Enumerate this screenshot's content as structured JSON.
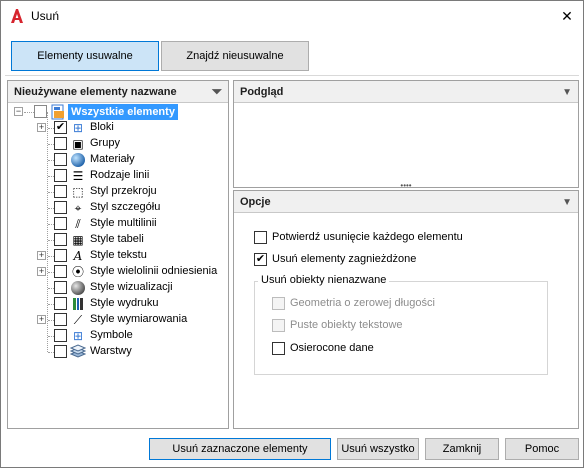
{
  "window": {
    "title": "Usuń"
  },
  "tabs": [
    {
      "label": "Elementy usuwalne",
      "active": true
    },
    {
      "label": "Znajdź nieusuwalne",
      "active": false
    }
  ],
  "left_panel": {
    "header": "Nieużywane elementy nazwane",
    "root": {
      "label": "Wszystkie elementy",
      "checked": false
    },
    "items": [
      {
        "label": "Bloki",
        "checked": true,
        "expandable": true,
        "icon": "block-icon"
      },
      {
        "label": "Grupy",
        "checked": false,
        "expandable": false,
        "icon": "group-icon"
      },
      {
        "label": "Materiały",
        "checked": false,
        "expandable": false,
        "icon": "material-sphere-icon"
      },
      {
        "label": "Rodzaje linii",
        "checked": false,
        "expandable": false,
        "icon": "linetype-icon"
      },
      {
        "label": "Styl przekroju",
        "checked": false,
        "expandable": false,
        "icon": "section-style-icon"
      },
      {
        "label": "Styl szczegółu",
        "checked": false,
        "expandable": false,
        "icon": "detail-style-icon"
      },
      {
        "label": "Style multilinii",
        "checked": false,
        "expandable": false,
        "icon": "multiline-style-icon"
      },
      {
        "label": "Style tabeli",
        "checked": false,
        "expandable": false,
        "icon": "table-style-icon"
      },
      {
        "label": "Style tekstu",
        "checked": false,
        "expandable": true,
        "icon": "text-style-icon"
      },
      {
        "label": "Style wielolinii odniesienia",
        "checked": false,
        "expandable": true,
        "icon": "multileader-style-icon"
      },
      {
        "label": "Style wizualizacji",
        "checked": false,
        "expandable": false,
        "icon": "visual-style-icon"
      },
      {
        "label": "Style wydruku",
        "checked": false,
        "expandable": false,
        "icon": "plot-style-icon"
      },
      {
        "label": "Style wymiarowania",
        "checked": false,
        "expandable": true,
        "icon": "dimension-style-icon"
      },
      {
        "label": "Symbole",
        "checked": false,
        "expandable": false,
        "icon": "symbol-icon"
      },
      {
        "label": "Warstwy",
        "checked": false,
        "expandable": false,
        "icon": "layers-icon"
      }
    ]
  },
  "preview_panel": {
    "header": "Podgląd"
  },
  "options_panel": {
    "header": "Opcje",
    "confirm_each": {
      "label": "Potwierdź usunięcie każdego elementu",
      "checked": false
    },
    "purge_nested": {
      "label": "Usuń elementy zagnieżdżone",
      "checked": true
    },
    "unnamed_group": {
      "legend": "Usuń obiekty nienazwane",
      "zero_length": {
        "label": "Geometria o zerowej długości",
        "checked": false,
        "enabled": false
      },
      "empty_text": {
        "label": "Puste obiekty tekstowe",
        "checked": false,
        "enabled": false
      },
      "orphaned_data": {
        "label": "Osierocone dane",
        "checked": false,
        "enabled": true
      }
    }
  },
  "buttons": {
    "purge_checked": "Usuń zaznaczone elementy",
    "purge_all": "Usuń wszystko",
    "close": "Zamknij",
    "help": "Pomoc"
  },
  "colors": {
    "selection": "#3399ff",
    "active_tab": "#cce4f7",
    "accent_border": "#0078d7",
    "app_icon_red": "#d6252e"
  }
}
